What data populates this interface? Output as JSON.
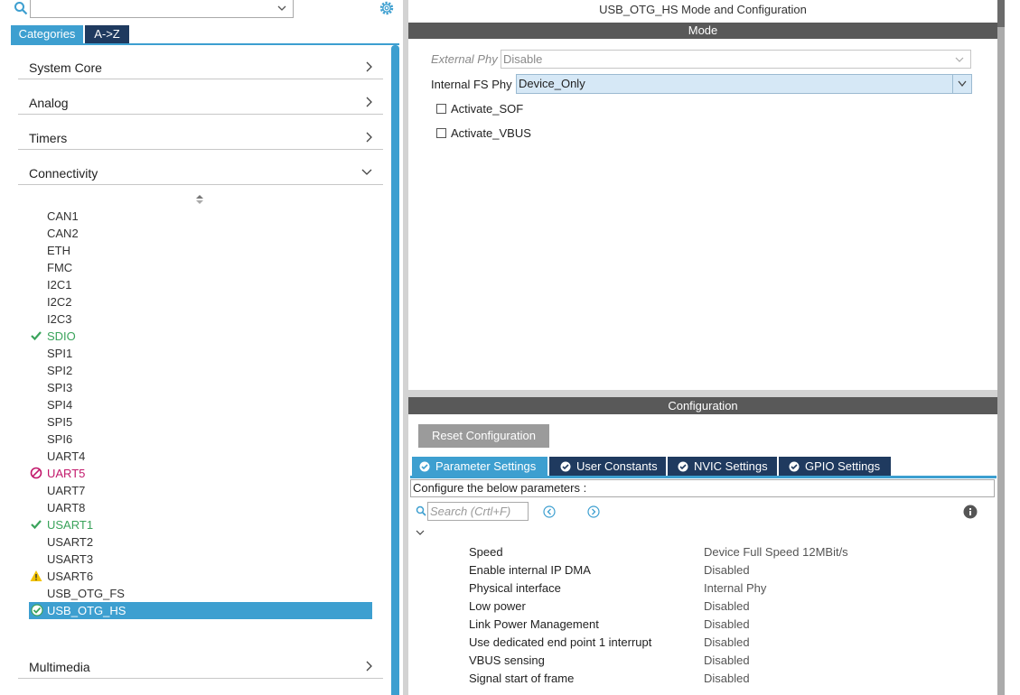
{
  "left": {
    "tabs": {
      "categories": "Categories",
      "az": "A->Z"
    },
    "categories": [
      {
        "label": "System Core"
      },
      {
        "label": "Analog"
      },
      {
        "label": "Timers"
      },
      {
        "label": "Connectivity"
      }
    ],
    "connectivity_items": [
      {
        "label": "CAN1",
        "status": "none"
      },
      {
        "label": "CAN2",
        "status": "none"
      },
      {
        "label": "ETH",
        "status": "none"
      },
      {
        "label": "FMC",
        "status": "none"
      },
      {
        "label": "I2C1",
        "status": "none"
      },
      {
        "label": "I2C2",
        "status": "none"
      },
      {
        "label": "I2C3",
        "status": "none"
      },
      {
        "label": "SDIO",
        "status": "ok"
      },
      {
        "label": "SPI1",
        "status": "none"
      },
      {
        "label": "SPI2",
        "status": "none"
      },
      {
        "label": "SPI3",
        "status": "none"
      },
      {
        "label": "SPI4",
        "status": "none"
      },
      {
        "label": "SPI5",
        "status": "none"
      },
      {
        "label": "SPI6",
        "status": "none"
      },
      {
        "label": "UART4",
        "status": "none"
      },
      {
        "label": "UART5",
        "status": "blocked"
      },
      {
        "label": "UART7",
        "status": "none"
      },
      {
        "label": "UART8",
        "status": "none"
      },
      {
        "label": "USART1",
        "status": "ok"
      },
      {
        "label": "USART2",
        "status": "none"
      },
      {
        "label": "USART3",
        "status": "none"
      },
      {
        "label": "USART6",
        "status": "warning"
      },
      {
        "label": "USB_OTG_FS",
        "status": "none"
      },
      {
        "label": "USB_OTG_HS",
        "status": "selected"
      }
    ],
    "multimedia": "Multimedia"
  },
  "right": {
    "title": "USB_OTG_HS Mode and Configuration",
    "mode_header": "Mode",
    "external_phy": {
      "label": "External Phy",
      "value": "Disable"
    },
    "internal_fs_phy": {
      "label": "Internal FS Phy",
      "value": "Device_Only"
    },
    "activate_sof": "Activate_SOF",
    "activate_vbus": "Activate_VBUS",
    "config_header": "Configuration",
    "reset_button": "Reset Configuration",
    "tabs": [
      "Parameter Settings",
      "User Constants",
      "NVIC Settings",
      "GPIO Settings"
    ],
    "configure_text": "Configure the below parameters :",
    "search_placeholder": "Search (Crtl+F)",
    "params": [
      {
        "name": "Speed",
        "value": "Device Full Speed 12MBit/s"
      },
      {
        "name": "Enable internal IP DMA",
        "value": "Disabled"
      },
      {
        "name": "Physical interface",
        "value": "Internal Phy"
      },
      {
        "name": "Low power",
        "value": "Disabled"
      },
      {
        "name": "Link Power Management",
        "value": "Disabled"
      },
      {
        "name": "Use dedicated end point 1 interrupt",
        "value": "Disabled"
      },
      {
        "name": "VBUS sensing",
        "value": "Disabled"
      },
      {
        "name": "Signal start of frame",
        "value": "Disabled"
      }
    ]
  },
  "colors": {
    "accent": "#3d9fd0",
    "dark_tab": "#1f3a5f",
    "header_bar": "#595959",
    "ok": "#3aa35b",
    "error": "#c2186b",
    "warning": "#f2c200"
  },
  "icons": [
    "search-icon",
    "gear-icon",
    "chevron-right-icon",
    "chevron-down-icon",
    "check-icon",
    "blocked-icon",
    "warning-icon",
    "check-circle-icon",
    "info-icon",
    "arrow-left-circle-icon",
    "arrow-right-circle-icon"
  ]
}
